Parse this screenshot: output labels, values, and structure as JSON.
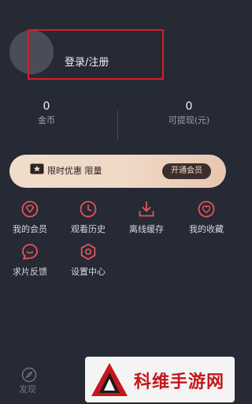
{
  "profile": {
    "login_label": "登录/注册"
  },
  "stats": {
    "coins_value": "0",
    "coins_label": "金币",
    "cash_value": "0",
    "cash_label": "可提现(元)"
  },
  "vip_banner": {
    "text": "限时优惠 限量",
    "button_label": "开通会员"
  },
  "menu": {
    "items": [
      {
        "label": "我的会员",
        "icon": "diamond-icon"
      },
      {
        "label": "观看历史",
        "icon": "clock-icon"
      },
      {
        "label": "离线缓存",
        "icon": "download-icon"
      },
      {
        "label": "我的收藏",
        "icon": "heart-icon"
      },
      {
        "label": "求片反馈",
        "icon": "chat-icon"
      },
      {
        "label": "设置中心",
        "icon": "gear-icon"
      }
    ]
  },
  "bottom_nav": {
    "discover_label": "发现"
  },
  "watermark": {
    "text": "科维手游网"
  },
  "colors": {
    "background": "#262a35",
    "accent": "#e8545a",
    "vip_gold": "#f0d8c6",
    "highlight_border": "#d0202c"
  }
}
